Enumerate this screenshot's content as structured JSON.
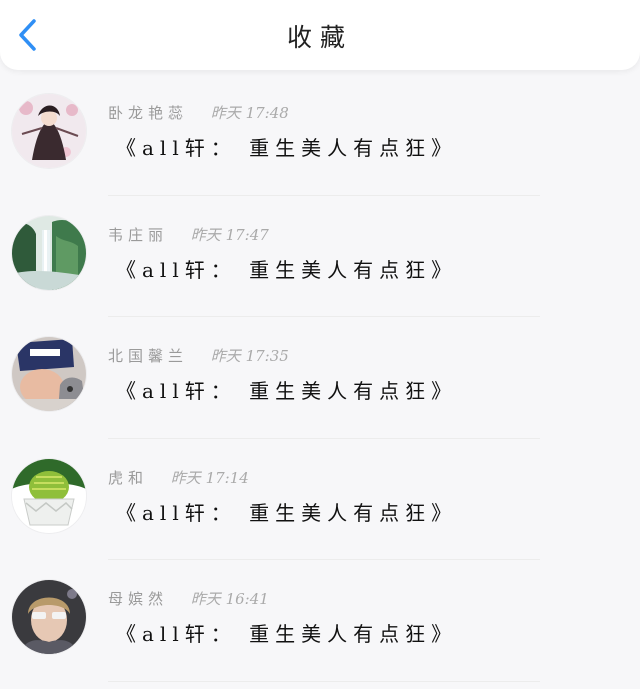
{
  "header": {
    "title": "收藏",
    "back_icon": "chevron-left-icon",
    "accent": "#2f8ff5"
  },
  "items": [
    {
      "name": "卧龙艳蕊",
      "time": "昨天 17:48",
      "text": "《all轩：  重生美人有点狂》"
    },
    {
      "name": "韦庄丽",
      "time": "昨天 17:47",
      "text": "《all轩：  重生美人有点狂》"
    },
    {
      "name": "北国馨兰",
      "time": "昨天 17:35",
      "text": "《all轩：  重生美人有点狂》"
    },
    {
      "name": "虎和",
      "time": "昨天 17:14",
      "text": "《all轩：  重生美人有点狂》"
    },
    {
      "name": "母嫔然",
      "time": "昨天 16:41",
      "text": "《all轩：  重生美人有点狂》"
    }
  ]
}
